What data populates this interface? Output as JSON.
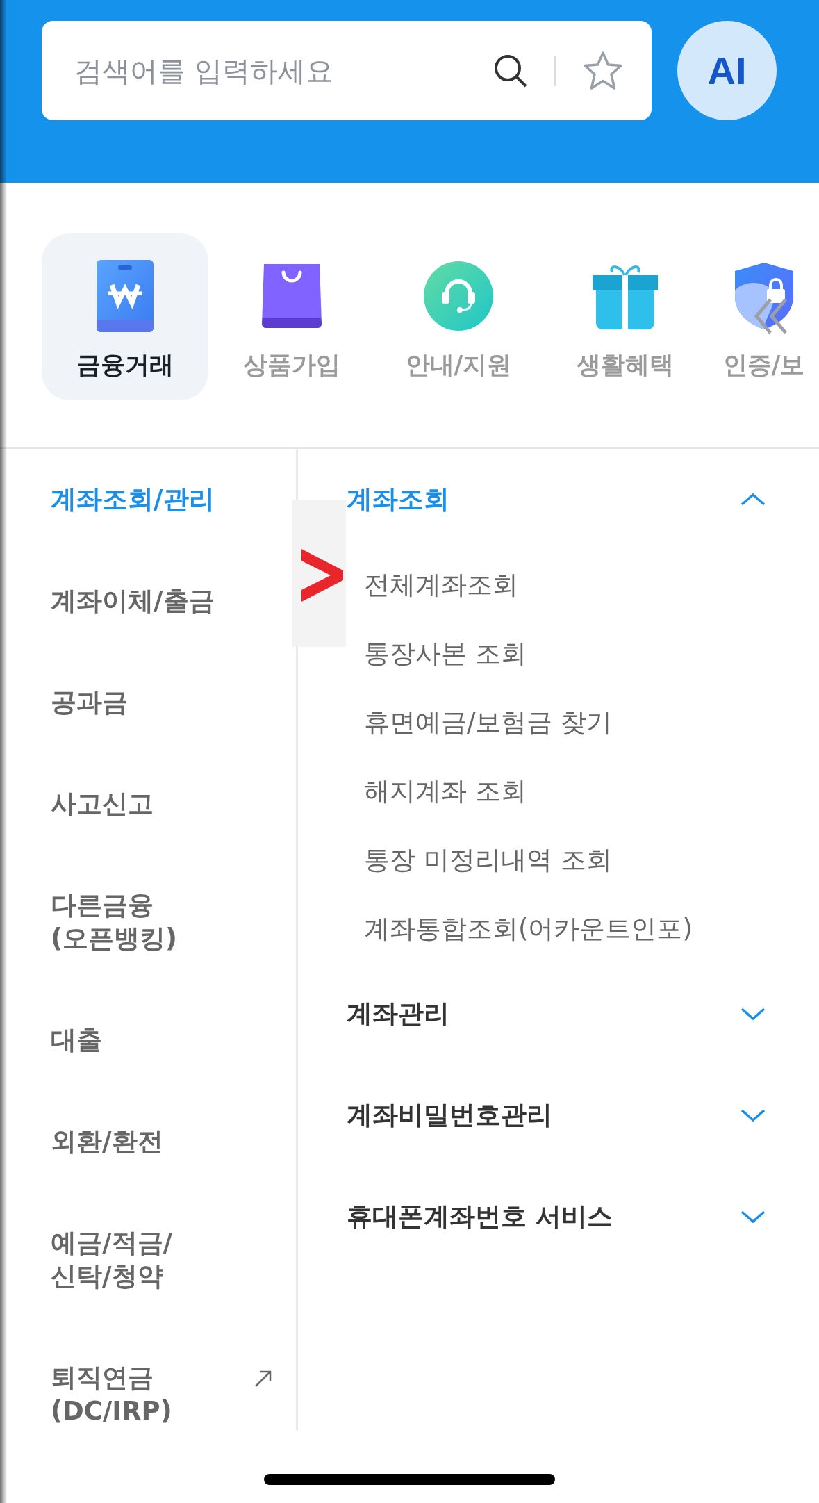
{
  "search": {
    "placeholder": "검색어를 입력하세요"
  },
  "ai_button": {
    "label": "AI"
  },
  "categories": [
    {
      "label": "금융거래",
      "selected": true
    },
    {
      "label": "상품가입",
      "selected": false
    },
    {
      "label": "안내/지원",
      "selected": false
    },
    {
      "label": "생활혜택",
      "selected": false
    },
    {
      "label": "인증/보",
      "selected": false
    }
  ],
  "sidebar": {
    "items": [
      {
        "label": "계좌조회/관리",
        "selected": true,
        "external": false
      },
      {
        "label": "계좌이체/출금",
        "selected": false,
        "external": false
      },
      {
        "label": "공과금",
        "selected": false,
        "external": false
      },
      {
        "label": "사고신고",
        "selected": false,
        "external": false
      },
      {
        "label": "다른금융\n(오픈뱅킹)",
        "selected": false,
        "external": false
      },
      {
        "label": "대출",
        "selected": false,
        "external": false
      },
      {
        "label": "외환/환전",
        "selected": false,
        "external": false
      },
      {
        "label": "예금/적금/\n신탁/청약",
        "selected": false,
        "external": false
      },
      {
        "label": "퇴직연금\n(DC/IRP)",
        "selected": false,
        "external": true
      }
    ]
  },
  "menu_sections": [
    {
      "title": "계좌조회",
      "expanded": true,
      "items": [
        "전체계좌조회",
        "통장사본 조회",
        "휴면예금/보험금 찾기",
        "해지계좌 조회",
        "통장 미정리내역 조회",
        "계좌통합조회(어카운트인포)"
      ]
    },
    {
      "title": "계좌관리",
      "expanded": false
    },
    {
      "title": "계좌비밀번호관리",
      "expanded": false
    },
    {
      "title": "휴대폰계좌번호 서비스",
      "expanded": false
    }
  ]
}
